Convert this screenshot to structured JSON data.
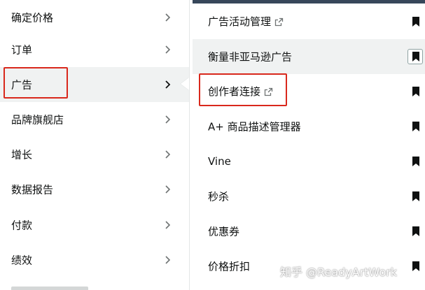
{
  "left_menu": {
    "items": [
      {
        "label": "确定价格"
      },
      {
        "label": "订单"
      },
      {
        "label": "广告"
      },
      {
        "label": "品牌旗舰店"
      },
      {
        "label": "增长"
      },
      {
        "label": "数据报告"
      },
      {
        "label": "付款"
      },
      {
        "label": "绩效"
      }
    ],
    "active_index": 2
  },
  "sub_menu": {
    "items": [
      {
        "label": "广告活动管理",
        "external": true
      },
      {
        "label": "衡量非亚马逊广告",
        "external": false
      },
      {
        "label": "创作者连接",
        "external": true
      },
      {
        "label": "A+ 商品描述管理器",
        "external": false
      },
      {
        "label": "Vine",
        "external": false
      },
      {
        "label": "秒杀",
        "external": false
      },
      {
        "label": "优惠券",
        "external": false
      },
      {
        "label": "价格折扣",
        "external": false
      }
    ]
  },
  "watermark": {
    "text": "知乎 @ReadyArtWork"
  },
  "icons": {
    "chevron": "chevron-right-icon",
    "external": "external-link-icon",
    "bookmark": "bookmark-icon"
  },
  "colors": {
    "highlight": "#d9281c",
    "top_bar": "#37475a",
    "active_bg": "#f0f2f2"
  }
}
